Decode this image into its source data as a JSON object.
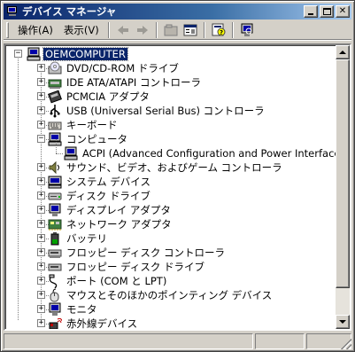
{
  "window": {
    "title": "デバイス マネージャ",
    "buttons": {
      "minimize": "",
      "maximize": "",
      "close": "✕"
    }
  },
  "menu": {
    "action": "操作(A)",
    "view": "表示(V)"
  },
  "toolbar": {
    "tools": [
      "back-icon",
      "forward-icon",
      "up-icon",
      "properties-icon",
      "help-icon",
      "scan-icon"
    ]
  },
  "tree": {
    "root": {
      "label": "OEMCOMPUTER",
      "selected": true,
      "icon": "computer-icon"
    },
    "items": [
      {
        "label": "DVD/CD-ROM ドライブ",
        "icon": "cdrom-icon",
        "expander": "+"
      },
      {
        "label": "IDE ATA/ATAPI コントローラ",
        "icon": "ide-icon",
        "expander": "+"
      },
      {
        "label": "PCMCIA アダプタ",
        "icon": "pcmcia-icon",
        "expander": "+"
      },
      {
        "label": "USB (Universal Serial Bus) コントローラ",
        "icon": "usb-icon",
        "expander": "+"
      },
      {
        "label": "キーボード",
        "icon": "keyboard-icon",
        "expander": "+"
      },
      {
        "label": "コンピュータ",
        "icon": "computer-icon",
        "expander": "-",
        "children": [
          {
            "label": "ACPI (Advanced Configuration and Power Interface) PC",
            "icon": "computer-icon"
          }
        ]
      },
      {
        "label": "サウンド、ビデオ、およびゲーム コントローラ",
        "icon": "sound-icon",
        "expander": "+"
      },
      {
        "label": "システム デバイス",
        "icon": "system-icon",
        "expander": "+"
      },
      {
        "label": "ディスク ドライブ",
        "icon": "disk-icon",
        "expander": "+"
      },
      {
        "label": "ディスプレイ アダプタ",
        "icon": "display-icon",
        "expander": "+"
      },
      {
        "label": "ネットワーク アダプタ",
        "icon": "network-icon",
        "expander": "+"
      },
      {
        "label": "バッテリ",
        "icon": "battery-icon",
        "expander": "+"
      },
      {
        "label": "フロッピー ディスク コントローラ",
        "icon": "floppy-controller-icon",
        "expander": "+"
      },
      {
        "label": "フロッピー ディスク ドライブ",
        "icon": "floppy-icon",
        "expander": "+"
      },
      {
        "label": "ポート (COM と LPT)",
        "icon": "port-icon",
        "expander": "+"
      },
      {
        "label": "マウスとそのほかのポインティング デバイス",
        "icon": "mouse-icon",
        "expander": "+"
      },
      {
        "label": "モニタ",
        "icon": "monitor-icon",
        "expander": "+"
      },
      {
        "label": "赤外線デバイス",
        "icon": "infrared-icon",
        "expander": "+"
      }
    ]
  },
  "colors": {
    "selection": "#0a246a",
    "chrome": "#d4d0c8",
    "title_start": "#0a246a",
    "title_end": "#a6caf0"
  }
}
